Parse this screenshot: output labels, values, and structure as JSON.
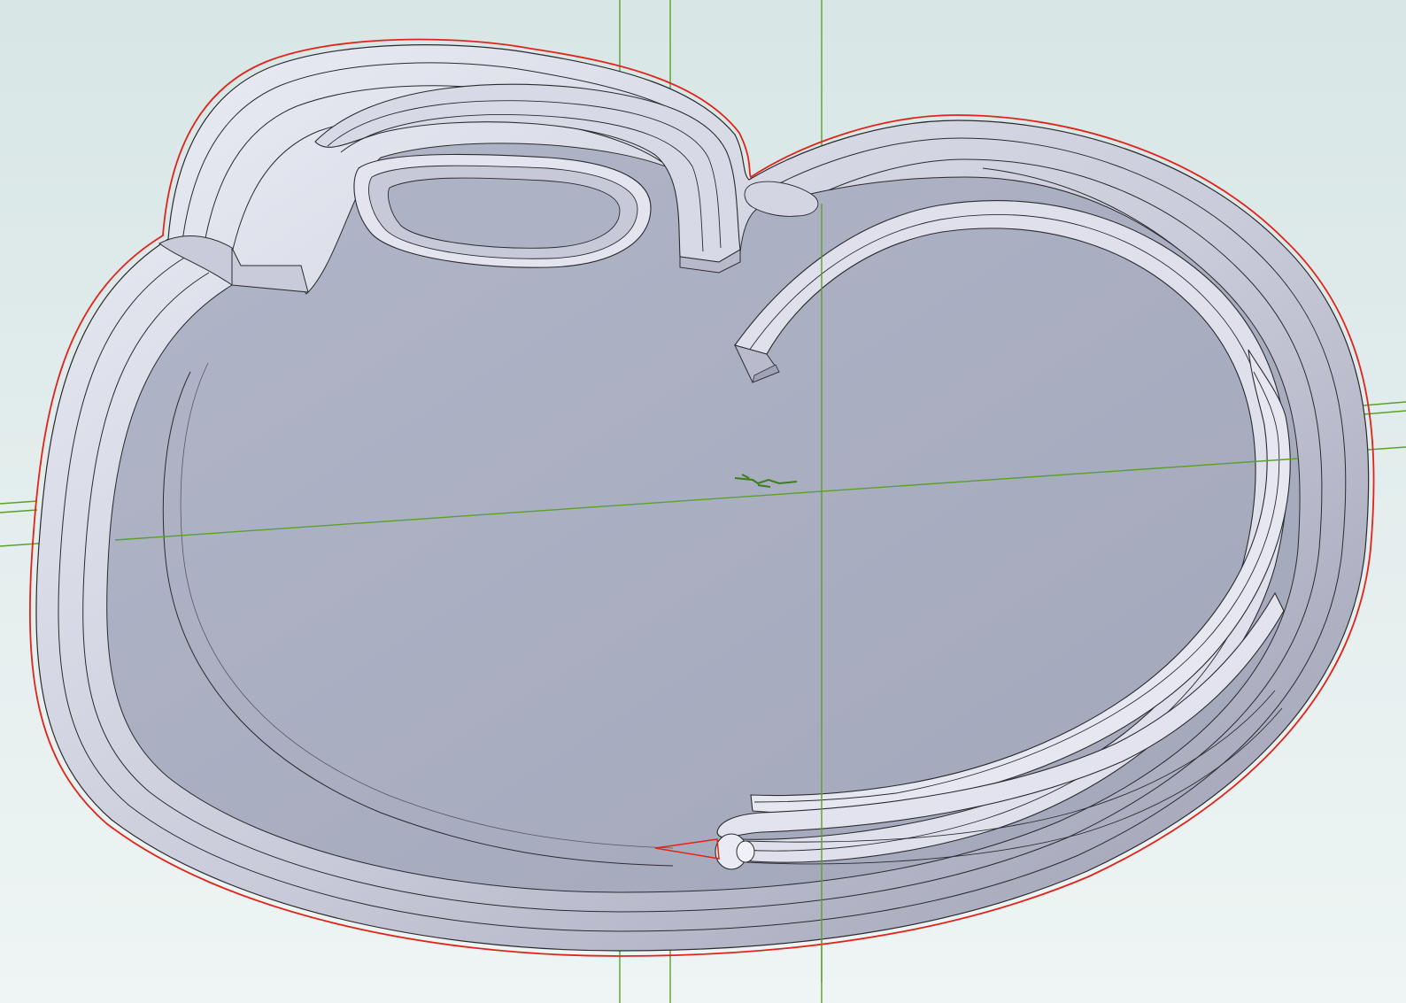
{
  "viewport": {
    "kind": "3d-cad-viewport",
    "background_top": "#d8e6e6",
    "background_bottom": "#eef5f4"
  },
  "colors": {
    "axis_green": "#5aa02c",
    "silhouette_red": "#e2231a",
    "edge_line": "#2b2b2e",
    "plate_face": "#a7abbf",
    "rim_light": "#e3e4ef",
    "rim_mid": "#c4c6d6",
    "rim_dark": "#8e91a4",
    "origin_marker": "#3d7d1a"
  },
  "model": {
    "visible_features": [
      "base-plate",
      "outer-rim",
      "inner-loop-rib",
      "handle-rib",
      "right-arc-rib",
      "hook-rib",
      "bottom-tail-rib"
    ]
  },
  "icons": {
    "origin": "origin-triad-icon"
  }
}
